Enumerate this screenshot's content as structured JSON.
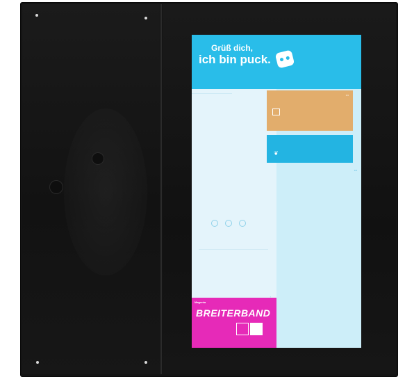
{
  "screen": {
    "greeting_line1": "Grüß dich,",
    "greeting_line2": "ich bin puck.",
    "time": "",
    "date": "",
    "left_tab": "",
    "left_footer": "",
    "orange_card": {
      "header": "",
      "line1": "",
      "line2": ""
    },
    "blue_card": {
      "header": "",
      "line1": ""
    },
    "right_col_title": "",
    "ad": {
      "brand": "Magenta",
      "banner": "BREITERBAND",
      "copy": "",
      "footer": ""
    }
  },
  "colors": {
    "hero": "#29bde9",
    "orange_card": "#e2ad6c",
    "blue_card": "#23b4e2",
    "ad": "#e62ab8"
  },
  "icons": [
    "mascot-icon",
    "menu-icon",
    "chevron-right-icon",
    "leaf-icon",
    "checkbox-icon"
  ],
  "brand_text": ""
}
